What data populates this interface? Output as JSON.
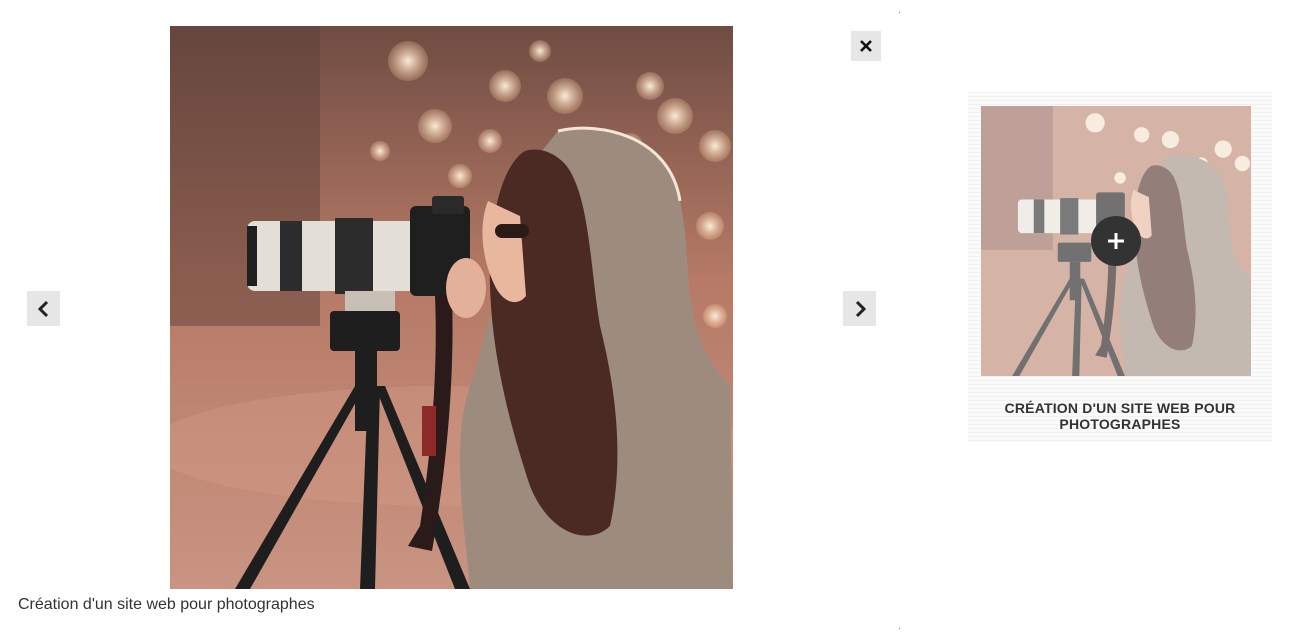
{
  "lightbox": {
    "caption": "Création d'un site web pour photographes",
    "prev_icon": "chevron-left-icon",
    "next_icon": "chevron-right-icon",
    "close_icon": "close-icon",
    "photo_alt": "photographer-with-camera-on-tripod"
  },
  "card": {
    "title": "Création d'un site web pour photographes",
    "expand_icon": "plus-icon"
  },
  "colors": {
    "button_bg": "#e6e6e6",
    "text": "#333333",
    "overlay": "#333333",
    "photo_tone": "#b8826f"
  }
}
